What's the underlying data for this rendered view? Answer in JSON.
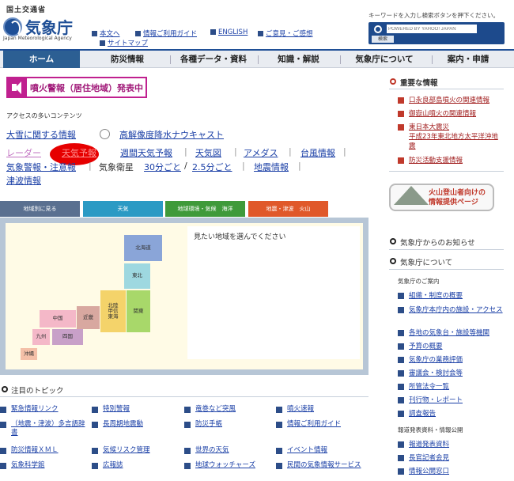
{
  "header": {
    "ministry": "国土交通省",
    "logo_text": "気象庁",
    "logo_en": "Japan Meteorological Agency",
    "links": [
      "本文へ",
      "情報ご利用ガイド",
      "ENGLISH",
      "ご意見・ご感想",
      "サイトマップ"
    ],
    "search_hint": "キーワードを入力し検索ボタンを押下ください。",
    "search_placeholder": "POWERED BY YAHOO! JAPAN",
    "search_button": "検索"
  },
  "nav": {
    "items": [
      "ホーム",
      "防災情報",
      "各種データ・資料",
      "知識・解説",
      "気象庁について",
      "案内・申請"
    ],
    "active_index": 0
  },
  "alert": {
    "label": "噴火警報（居住地域）発表中",
    "color": "#c0208f"
  },
  "access": {
    "title": "アクセスの多いコンテンツ",
    "row1": [
      "大雪に関する情報",
      "高解像度降水ナウキャスト"
    ],
    "row2": [
      "レーダー",
      "天気予報",
      "週間天気予報",
      "天気図",
      "アメダス",
      "台風情報"
    ],
    "row3": [
      "気象警報・注意報",
      "気象衛星",
      "30分ごと",
      "/",
      "2.5分ごと",
      "地震情報"
    ],
    "row4": [
      "津波情報"
    ]
  },
  "map_tabs": [
    {
      "label": "地域別に見る",
      "color": "#5a7090"
    },
    {
      "label": "天気",
      "color": "#2b9ac4"
    },
    {
      "label": "地球環境・気候　海洋",
      "color": "#3f9a3a"
    },
    {
      "label": "地震・津波　火山",
      "color": "#e0582a"
    }
  ],
  "map": {
    "prompt": "見たい地域を選んでください",
    "regions": [
      "北海道",
      "東北",
      "北陸\n甲信\n東海",
      "関東",
      "近畿",
      "中国",
      "四国",
      "九州",
      "沖縄"
    ]
  },
  "important": {
    "title": "重要な情報",
    "items": [
      "口永良部島噴火の関連情報",
      "御嶽山噴火の関連情報",
      "東日本大震災\n平成23年東北地方太平洋沖地震",
      "防災活動支援情報"
    ],
    "volcano_banner": "火山登山者向けの\n情報提供ページ"
  },
  "notice": {
    "title": "気象庁からのお知らせ"
  },
  "about": {
    "title": "気象庁について",
    "subtitle": "気象庁のご案内",
    "items": [
      "組織・制度の概要",
      "気象庁本庁内の施設・アクセス",
      "各地の気象台・施設等機関",
      "予算の概要",
      "気象庁の業務評価",
      "審議会・検討会等",
      "所管法令一覧",
      "刊行物・レポート",
      "調査報告"
    ],
    "subtitle2": "報道発表資料・情報公開",
    "items2": [
      "報道発表資料",
      "長官記者会見",
      "情報公開窓口"
    ]
  },
  "topics": {
    "title": "注目のトピック",
    "items": [
      "緊急情報リンク",
      "特別警報",
      "竜巻など突風",
      "噴火速報",
      "（地震・津波）多言語辞書",
      "長周期地震動",
      "防災手帳",
      "情報ご利用ガイド",
      "防災情報ＸＭＬ",
      "気候リスク管理",
      "世界の天気",
      "イベント情報",
      "気象科学館",
      "広報誌",
      "地球ウォッチャーズ",
      "民間の気象情報サービス"
    ]
  },
  "colors": {
    "brand": "#1f4f96",
    "alert": "#c0208f",
    "important": "#c0392b",
    "annotation": "#e60000"
  }
}
